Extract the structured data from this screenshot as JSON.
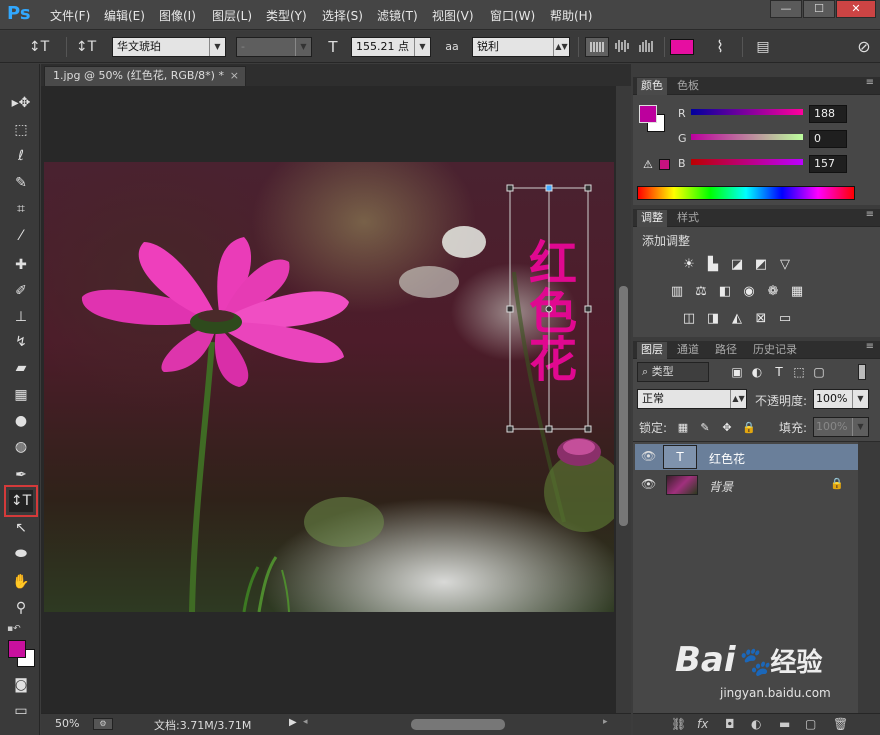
{
  "app": {
    "logo": "Ps"
  },
  "menu": [
    "文件(F)",
    "编辑(E)",
    "图像(I)",
    "图层(L)",
    "类型(Y)",
    "选择(S)",
    "滤镜(T)",
    "视图(V)",
    "窗口(W)",
    "帮助(H)"
  ],
  "window_controls": {
    "minimize": "—",
    "restore": "☐",
    "close": "✕"
  },
  "options": {
    "tool_preset": "↕T",
    "orient": "↕T",
    "font_family": "华文琥珀",
    "font_style": "-",
    "size_icon": "T",
    "font_size": "155.21 点",
    "aa_icon": "aa",
    "antialias": "锐利",
    "color": "#e60ea1"
  },
  "document": {
    "tab_title": "1.jpg @ 50% (红色花, RGB/8*) *",
    "tab_close": "×",
    "text_layer": "红色花",
    "text_color": "#e00890",
    "zoom": "50%",
    "doc_size": "文档:3.71M/3.71M"
  },
  "colors": {
    "foreground": "#c8109e",
    "background": "#ffffff"
  },
  "color_panel": {
    "tabs": [
      "颜色",
      "色板"
    ],
    "channels": [
      {
        "label": "R",
        "value": "188"
      },
      {
        "label": "G",
        "value": "0"
      },
      {
        "label": "B",
        "value": "157"
      }
    ],
    "foreground": "#bc009d"
  },
  "adjustments_panel": {
    "tabs": [
      "调整",
      "样式"
    ],
    "title": "添加调整"
  },
  "layers_panel": {
    "tabs": [
      "图层",
      "通道",
      "路径",
      "历史记录"
    ],
    "filter": "类型",
    "blend_mode": "正常",
    "opacity_label": "不透明度:",
    "opacity": "100%",
    "lock_label": "锁定:",
    "fill_label": "填充:",
    "fill": "100%",
    "layers": [
      {
        "name": "红色花",
        "type": "text"
      },
      {
        "name": "背景",
        "type": "image"
      }
    ]
  },
  "watermark": {
    "brand": "Bai",
    "brand_suffix": "经验",
    "url": "jingyan.baidu.com"
  }
}
